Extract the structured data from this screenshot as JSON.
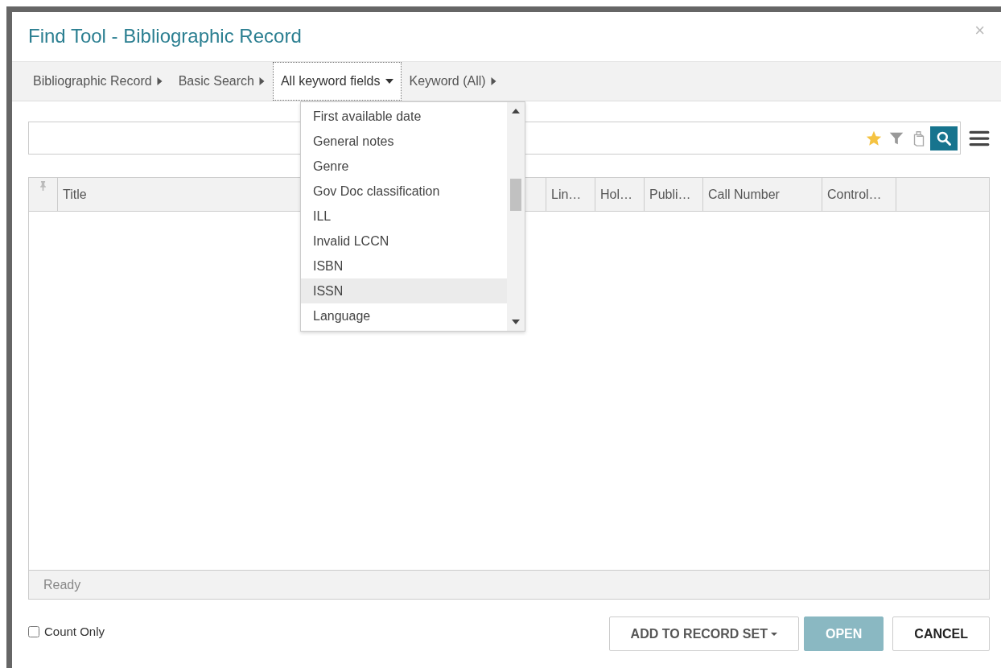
{
  "window": {
    "title": "Find Tool - Bibliographic Record",
    "close": "×"
  },
  "breadcrumbs": [
    {
      "label": "Bibliographic Record",
      "kind": "step",
      "selected": false
    },
    {
      "label": "Basic Search",
      "kind": "step",
      "selected": false
    },
    {
      "label": "All keyword fields",
      "kind": "dropdown",
      "selected": true
    },
    {
      "label": "Keyword (All)",
      "kind": "step",
      "selected": false
    }
  ],
  "dropdown": {
    "items": [
      {
        "label": "First available date",
        "selected": false
      },
      {
        "label": "General notes",
        "selected": false
      },
      {
        "label": "Genre",
        "selected": false
      },
      {
        "label": "Gov Doc classification",
        "selected": false
      },
      {
        "label": "ILL",
        "selected": false
      },
      {
        "label": "Invalid LCCN",
        "selected": false
      },
      {
        "label": "ISBN",
        "selected": false
      },
      {
        "label": "ISSN",
        "selected": true
      },
      {
        "label": "Language",
        "selected": false
      }
    ]
  },
  "table": {
    "columns": [
      "Title",
      "Lin…",
      "Hol…",
      "Publi…",
      "Call Number",
      "Control…"
    ]
  },
  "status_bar": "Ready",
  "count_only": {
    "label": "Count Only",
    "checked": false
  },
  "buttons": [
    {
      "label": "ADD TO RECORD SET",
      "kind": "menu",
      "disabled": false
    },
    {
      "label": "OPEN",
      "kind": "primary",
      "disabled": true
    },
    {
      "label": "CANCEL",
      "kind": "default",
      "disabled": false
    }
  ]
}
